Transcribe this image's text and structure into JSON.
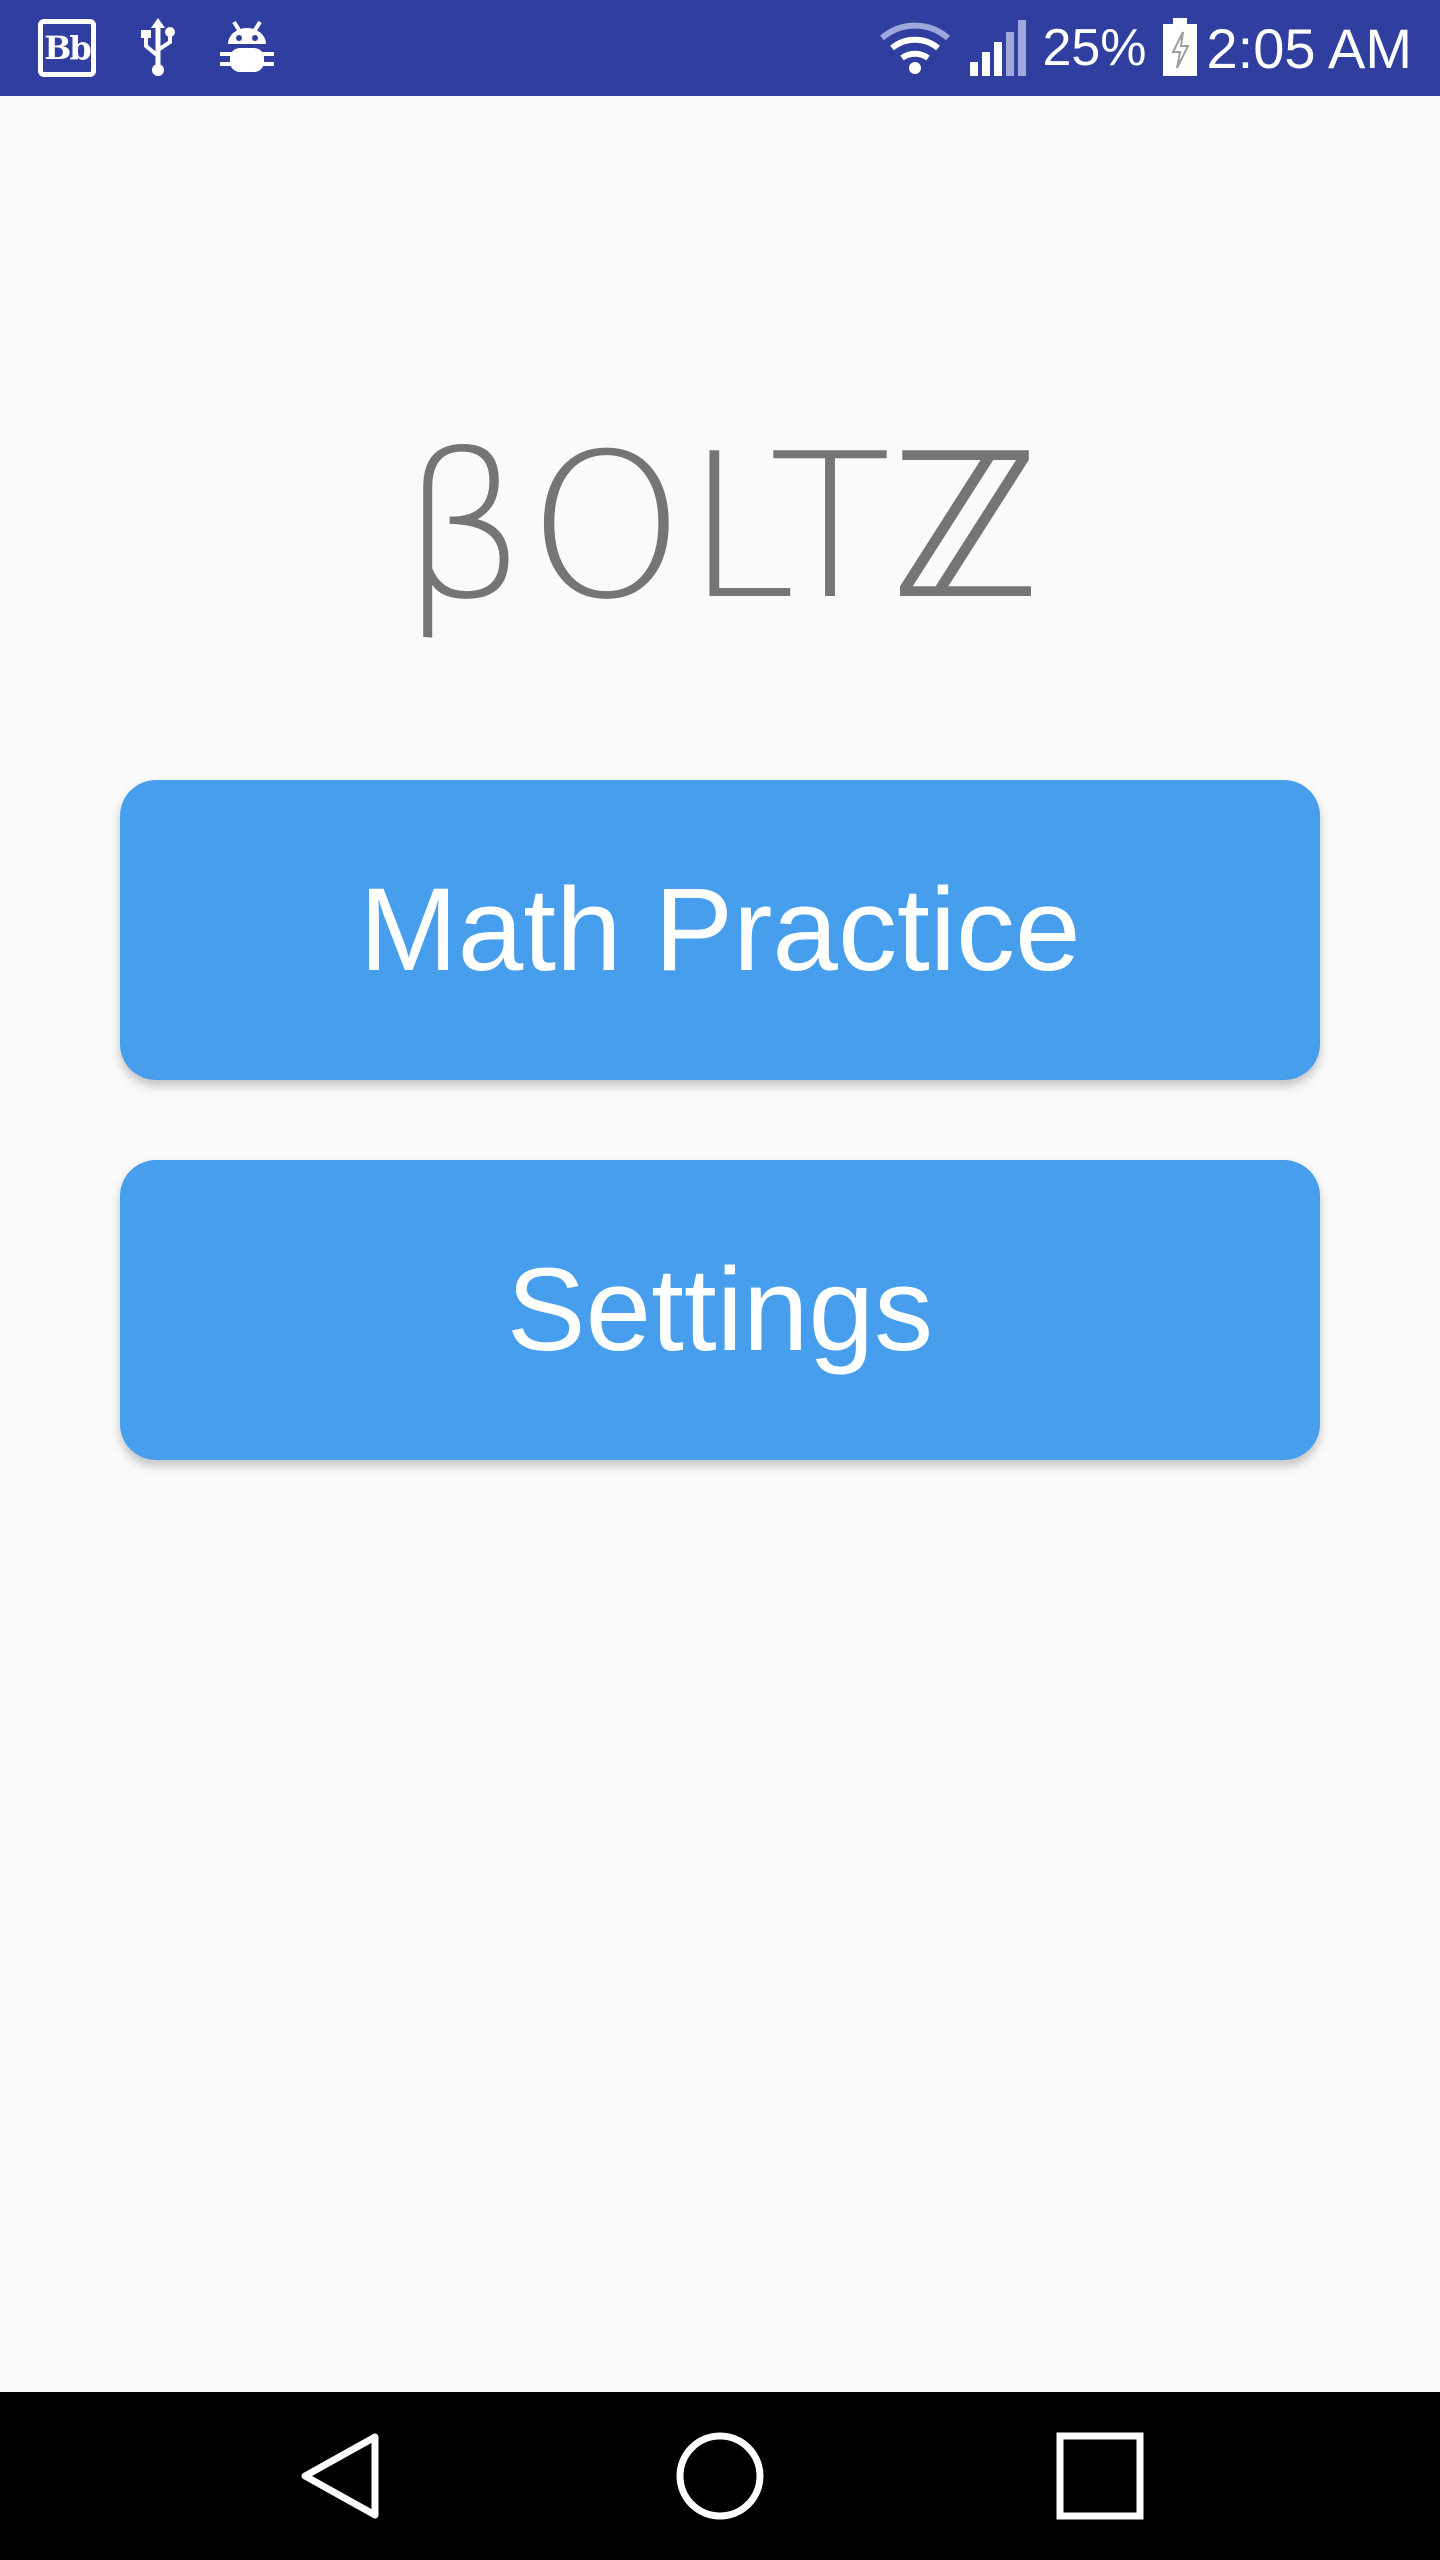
{
  "status_bar": {
    "bb_icon_text": "Bb",
    "battery_percent": "25%",
    "time": "2:05 AM",
    "icons": [
      "blackboard-icon",
      "usb-icon",
      "android-debug-icon",
      "wifi-icon",
      "signal-icon",
      "battery-charging-icon"
    ],
    "background_color": "#303f9f"
  },
  "app": {
    "title": "βOLTℤ"
  },
  "buttons": {
    "math_practice": "Math Practice",
    "settings": "Settings",
    "color": "#479eed"
  },
  "nav_bar": {
    "icons": [
      "back-icon",
      "home-icon",
      "recents-icon"
    ]
  }
}
